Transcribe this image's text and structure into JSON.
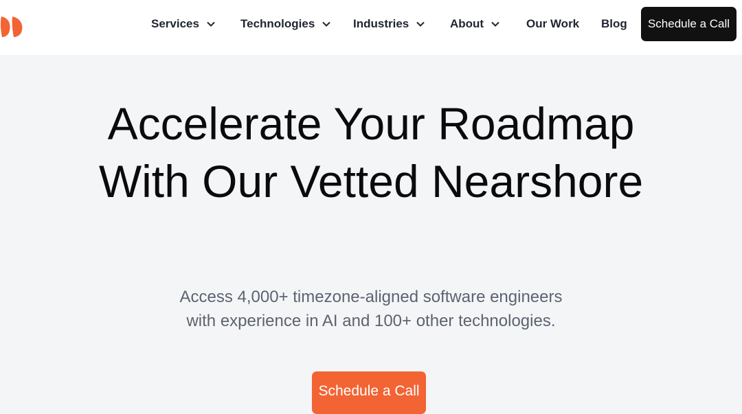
{
  "brand": {
    "logo_icon": "double-orange-leaf-logo",
    "accent_color": "#f26433"
  },
  "nav": {
    "items": [
      {
        "label": "Services",
        "has_dropdown": true
      },
      {
        "label": "Technologies",
        "has_dropdown": true
      },
      {
        "label": "Industries",
        "has_dropdown": true
      },
      {
        "label": "About",
        "has_dropdown": true
      },
      {
        "label": "Our Work",
        "has_dropdown": false
      },
      {
        "label": "Blog",
        "has_dropdown": false
      }
    ],
    "cta_label": "Schedule a Call"
  },
  "hero": {
    "title_line1": "Accelerate Your Roadmap",
    "title_line2": "With Our Vetted Nearshore",
    "subtitle_line1": "Access 4,000+ timezone-aligned software engineers",
    "subtitle_line2": "with experience in AI and 100+ other technologies.",
    "cta_label": "Schedule a Call"
  }
}
